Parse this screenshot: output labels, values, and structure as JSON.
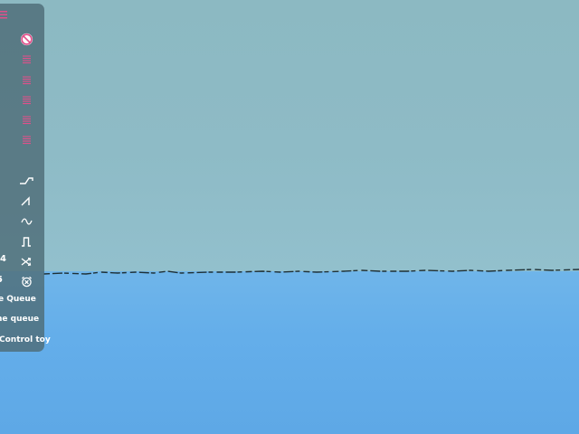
{
  "scene": {
    "sky_color": "#8ebbc6",
    "water_color": "#64aeea"
  },
  "panel": {
    "bg_color": "#4e6c78",
    "accent_color": "#e0508a",
    "menu_icon": "hamburger-icon",
    "stop_icon": "no-entry-icon",
    "preset_icons": [
      "list-icon",
      "list-icon",
      "list-icon",
      "list-icon",
      "list-icon"
    ],
    "wave_icons": [
      "ramp-wave-icon",
      "sawtooth-wave-icon",
      "sine-wave-icon",
      "square-wave-icon",
      "shuffle-icon"
    ],
    "alarm_icon": "alarm-clock-icon",
    "value_top": "4",
    "value_bottom": "5",
    "labels": {
      "queue_a": "e Queue",
      "queue_b": "ne queue",
      "control": "Control toy"
    }
  }
}
